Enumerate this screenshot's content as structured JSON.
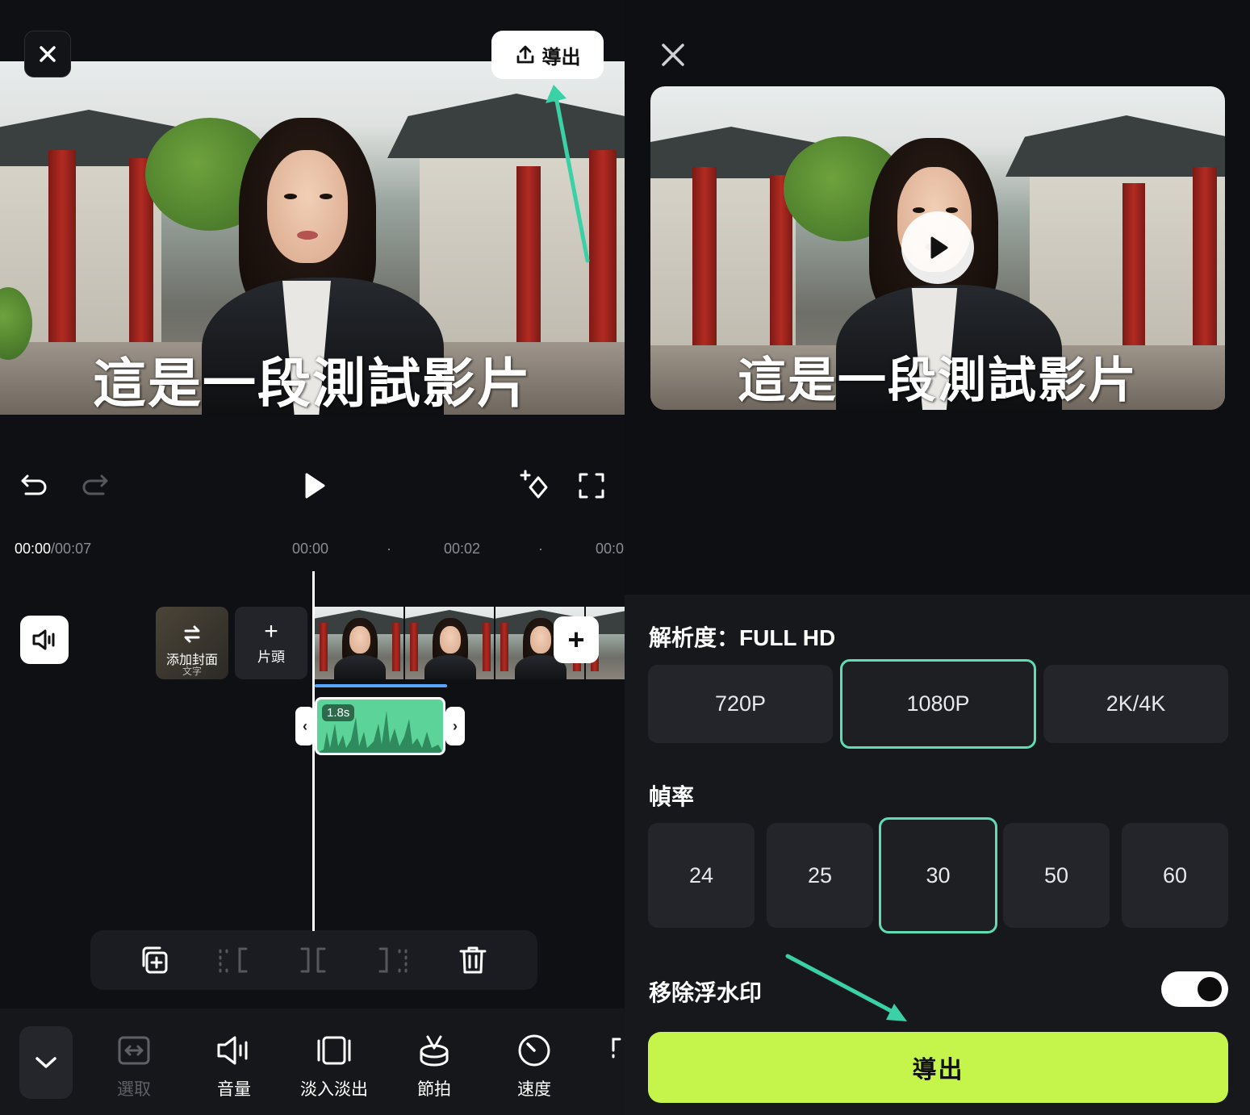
{
  "editor": {
    "export_label": "導出",
    "video_caption": "這是一段測試影片",
    "timecode": {
      "current": "00:00",
      "total": "/00:07"
    },
    "ruler_ticks": [
      "00:00",
      "00:02",
      "00:0"
    ],
    "cover": {
      "label": "添加封面",
      "sub": "文字"
    },
    "intro": {
      "plus": "+",
      "label": "片頭"
    },
    "add_clip": "+",
    "audio_clip": {
      "duration": "1.8s"
    },
    "nav": [
      {
        "label": "選取",
        "icon": "select-icon",
        "dim": true
      },
      {
        "label": "音量",
        "icon": "volume-icon",
        "dim": false
      },
      {
        "label": "淡入淡出",
        "icon": "fade-icon",
        "dim": false
      },
      {
        "label": "節拍",
        "icon": "beat-icon",
        "dim": false
      },
      {
        "label": "速度",
        "icon": "speed-icon",
        "dim": false
      }
    ],
    "colors": {
      "accent": "#5bd399",
      "highlight_arrow": "#3ad1a6"
    }
  },
  "export_panel": {
    "video_caption": "這是一段測試影片",
    "resolution": {
      "title": "解析度：FULL HD",
      "options": [
        "720P",
        "1080P",
        "2K/4K"
      ],
      "selected": "1080P"
    },
    "framerate": {
      "title": "幀率",
      "options": [
        "24",
        "25",
        "30",
        "50",
        "60"
      ],
      "selected": "30"
    },
    "watermark": {
      "label": "移除浮水印",
      "enabled": true
    },
    "export_label": "導出",
    "colors": {
      "export_button": "#c5f54a",
      "selected_border": "#5fdcb1"
    }
  }
}
